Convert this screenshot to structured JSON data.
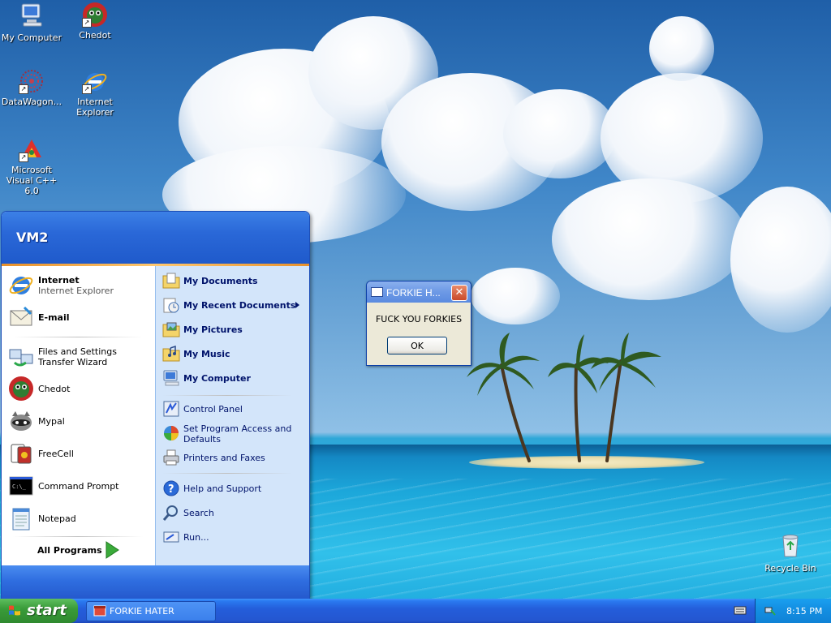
{
  "desktop": {
    "icons": [
      {
        "label": "My Computer"
      },
      {
        "label": "Chedot"
      },
      {
        "label": "DataWagon..."
      },
      {
        "label": "Internet Explorer"
      },
      {
        "label": "Microsoft Visual C++ 6.0"
      },
      {
        "label": "Recycle Bin"
      }
    ]
  },
  "start_menu": {
    "user": "VM2",
    "left_items": [
      {
        "title": "Internet",
        "subtitle": "Internet Explorer"
      },
      {
        "title": "E-mail"
      },
      {
        "title": "Files and Settings Transfer Wizard"
      },
      {
        "title": "Chedot"
      },
      {
        "title": "Mypal"
      },
      {
        "title": "FreeCell"
      },
      {
        "title": "Command Prompt"
      },
      {
        "title": "Notepad"
      }
    ],
    "all_programs": "All Programs",
    "right_items": [
      {
        "label": "My Documents"
      },
      {
        "label": "My Recent Documents"
      },
      {
        "label": "My Pictures"
      },
      {
        "label": "My Music"
      },
      {
        "label": "My Computer"
      },
      {
        "label": "Control Panel"
      },
      {
        "label": "Set Program Access and Defaults"
      },
      {
        "label": "Printers and Faxes"
      },
      {
        "label": "Help and Support"
      },
      {
        "label": "Search"
      },
      {
        "label": "Run..."
      }
    ]
  },
  "dialog": {
    "title": "FORKIE H...",
    "message": "FUCK YOU FORKIES",
    "ok_label": "OK",
    "close_symbol": "✕"
  },
  "taskbar": {
    "start_label": "start",
    "task_label": "FORKIE HATER",
    "clock": "8:15 PM"
  }
}
